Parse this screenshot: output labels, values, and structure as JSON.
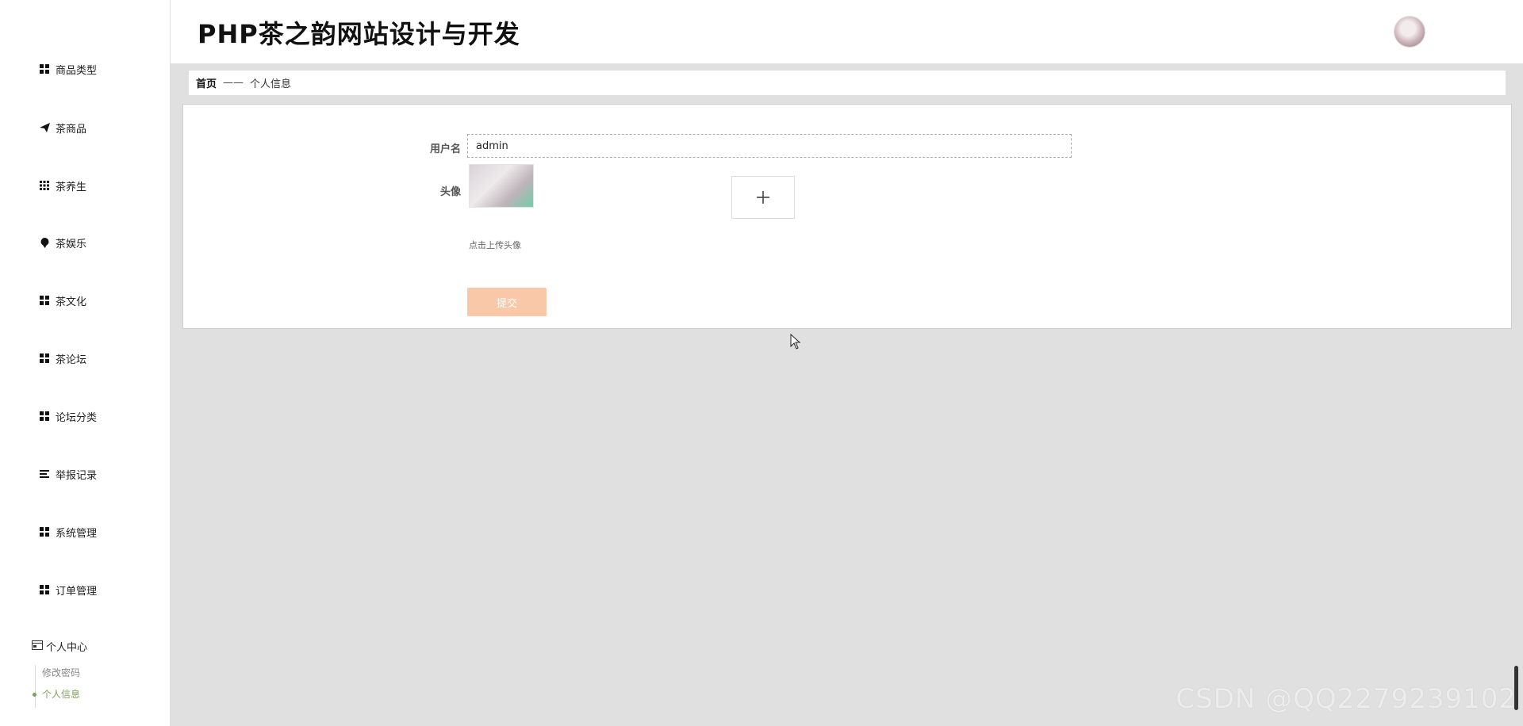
{
  "sidebar": {
    "items": [
      {
        "label": "商品类型",
        "icon": "grid-icon"
      },
      {
        "label": "茶商品",
        "icon": "paper-plane-icon"
      },
      {
        "label": "茶养生",
        "icon": "apps-icon"
      },
      {
        "label": "茶娱乐",
        "icon": "pin-icon"
      },
      {
        "label": "茶文化",
        "icon": "grid-icon"
      },
      {
        "label": "茶论坛",
        "icon": "grid-icon"
      },
      {
        "label": "论坛分类",
        "icon": "grid-icon"
      },
      {
        "label": "举报记录",
        "icon": "list-icon"
      },
      {
        "label": "系统管理",
        "icon": "grid-icon"
      },
      {
        "label": "订单管理",
        "icon": "grid-icon"
      }
    ],
    "personal_center": {
      "label": "个人中心",
      "icon": "window-icon",
      "children": [
        {
          "label": "修改密码",
          "active": false
        },
        {
          "label": "个人信息",
          "active": true
        }
      ]
    }
  },
  "header": {
    "title": "PHP茶之韵网站设计与开发"
  },
  "breadcrumb": {
    "home": "首页",
    "separator": "——",
    "current": "个人信息"
  },
  "form": {
    "username_label": "用户名",
    "username_value": "admin",
    "avatar_label": "头像",
    "upload_hint": "点击上传头像",
    "submit_label": "提交"
  },
  "watermark": "CSDN @QQ2279239102",
  "colors": {
    "accent_active": "#7ba356",
    "submit_button": "#f9c8a8",
    "content_background": "#e0e0e0"
  }
}
